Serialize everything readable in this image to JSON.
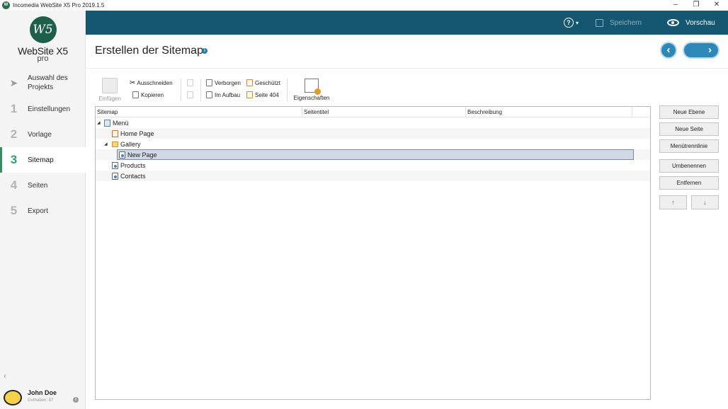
{
  "window": {
    "title": "Incomedia WebSite X5 Pro 2019.1.5",
    "app_icon_text": "W",
    "minimize": "–",
    "restore": "❐",
    "close": "✕"
  },
  "logo": {
    "mark": "W5",
    "name": "WebSite X5",
    "edition": "pro"
  },
  "nav": {
    "items": [
      {
        "num": "",
        "label": "Auswahl des Projekts",
        "icon": "rocket-icon"
      },
      {
        "num": "1",
        "label": "Einstellungen"
      },
      {
        "num": "2",
        "label": "Vorlage"
      },
      {
        "num": "3",
        "label": "Sitemap",
        "active": true
      },
      {
        "num": "4",
        "label": "Seiten"
      },
      {
        "num": "5",
        "label": "Export"
      }
    ],
    "collapse_glyph": "‹"
  },
  "user": {
    "name": "John Doe",
    "credit": "Guthaben: 87"
  },
  "header": {
    "help_glyph": "?",
    "chevron": "▾",
    "save_label": "Speichern",
    "preview_label": "Vorschau",
    "bg_color": "#155670"
  },
  "page": {
    "title": "Erstellen der Sitemap",
    "info_glyph": "i",
    "back_glyph": "‹",
    "next_glyph": "›"
  },
  "toolbar": {
    "paste": "Einfügen",
    "cut": "Ausschneiden",
    "copy": "Kopieren",
    "hidden": "Verborgen",
    "under_construction": "Im Aufbau",
    "protected": "Geschützt",
    "page404": "Seite 404",
    "properties": "Eigenschaften",
    "cut_glyph": "✂"
  },
  "grid": {
    "columns": [
      "Sitemap",
      "Seitentitel",
      "Beschreibung"
    ],
    "rows": [
      {
        "label": "Menü",
        "type": "menu",
        "expander": "◢"
      },
      {
        "label": "Home Page",
        "type": "home"
      },
      {
        "label": "Gallery",
        "type": "folder",
        "expander": "◢"
      },
      {
        "label": "New Page",
        "type": "page",
        "selected": true
      },
      {
        "label": "Products",
        "type": "page"
      },
      {
        "label": "Contacts",
        "type": "page"
      }
    ]
  },
  "actions": {
    "new_level": "Neue Ebene",
    "new_page": "Neue Seite",
    "menu_separator": "Menütrennlinie",
    "rename": "Umbenennen",
    "remove": "Entfernen",
    "move_up": "↑",
    "move_down": "↓"
  },
  "colors": {
    "accent": "#2f9e6a",
    "nav_button": "#2b88b8",
    "selection": "#d2d9e6"
  }
}
